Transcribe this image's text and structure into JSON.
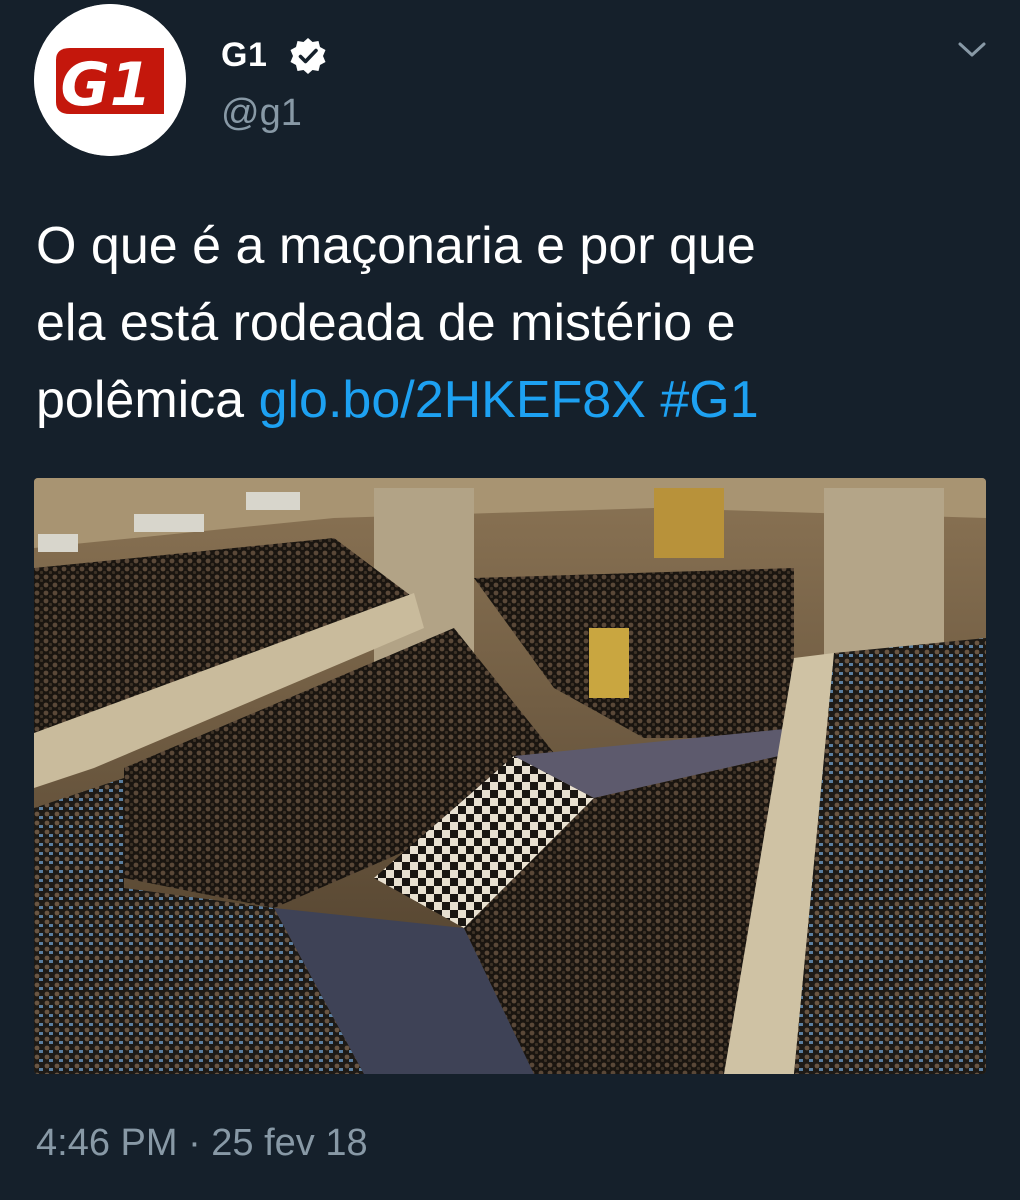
{
  "account": {
    "display_name": "G1",
    "handle": "@g1",
    "avatar_text": "G1",
    "verified": true
  },
  "tweet": {
    "text_lines": [
      "O que é a maçonaria e por que",
      "ela está rodeada de mistério e",
      "polêmica "
    ],
    "link": "glo.bo/2HKEF8X",
    "hashtag": "#G1",
    "timestamp": "4:46 PM · 25 fev 18"
  },
  "icons": {
    "verified": "verified-badge-icon",
    "menu": "chevron-down-icon"
  },
  "colors": {
    "background": "#15202b",
    "text": "#ffffff",
    "secondary": "#8899a6",
    "link": "#1da1f2",
    "brand_red": "#c4170c"
  }
}
